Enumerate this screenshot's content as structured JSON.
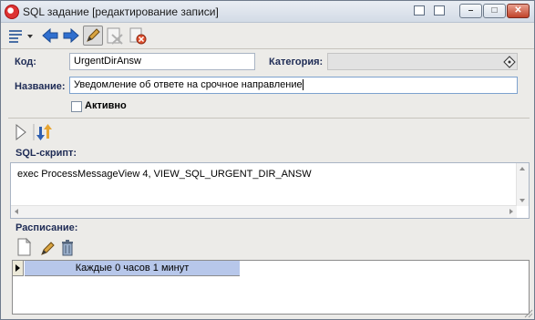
{
  "window": {
    "title": "SQL задание [редактирование записи]",
    "min_glyph": "–",
    "max_glyph": "□",
    "close_glyph": "✕"
  },
  "toolbar": {
    "buttons": [
      "menu-icon",
      "back-icon",
      "forward-icon",
      "edit-pencil-icon",
      "delete-icon",
      "cancel-icon"
    ]
  },
  "form": {
    "code_label": "Код:",
    "code_value": "UrgentDirAnsw",
    "category_label": "Категория:",
    "category_value": "",
    "name_label": "Название:",
    "name_value": "Уведомление об ответе на срочное направление",
    "active_label": "Активно",
    "active_checked": false
  },
  "script": {
    "label": "SQL-скрипт:",
    "text": "exec ProcessMessageView 4, VIEW_SQL_URGENT_DIR_ANSW"
  },
  "schedule": {
    "label": "Расписание:",
    "rows": [
      "Каждые 0 часов 1 минут"
    ]
  },
  "colors": {
    "label_blue": "#1e2b55",
    "selected_row": "#b7c7ea"
  }
}
